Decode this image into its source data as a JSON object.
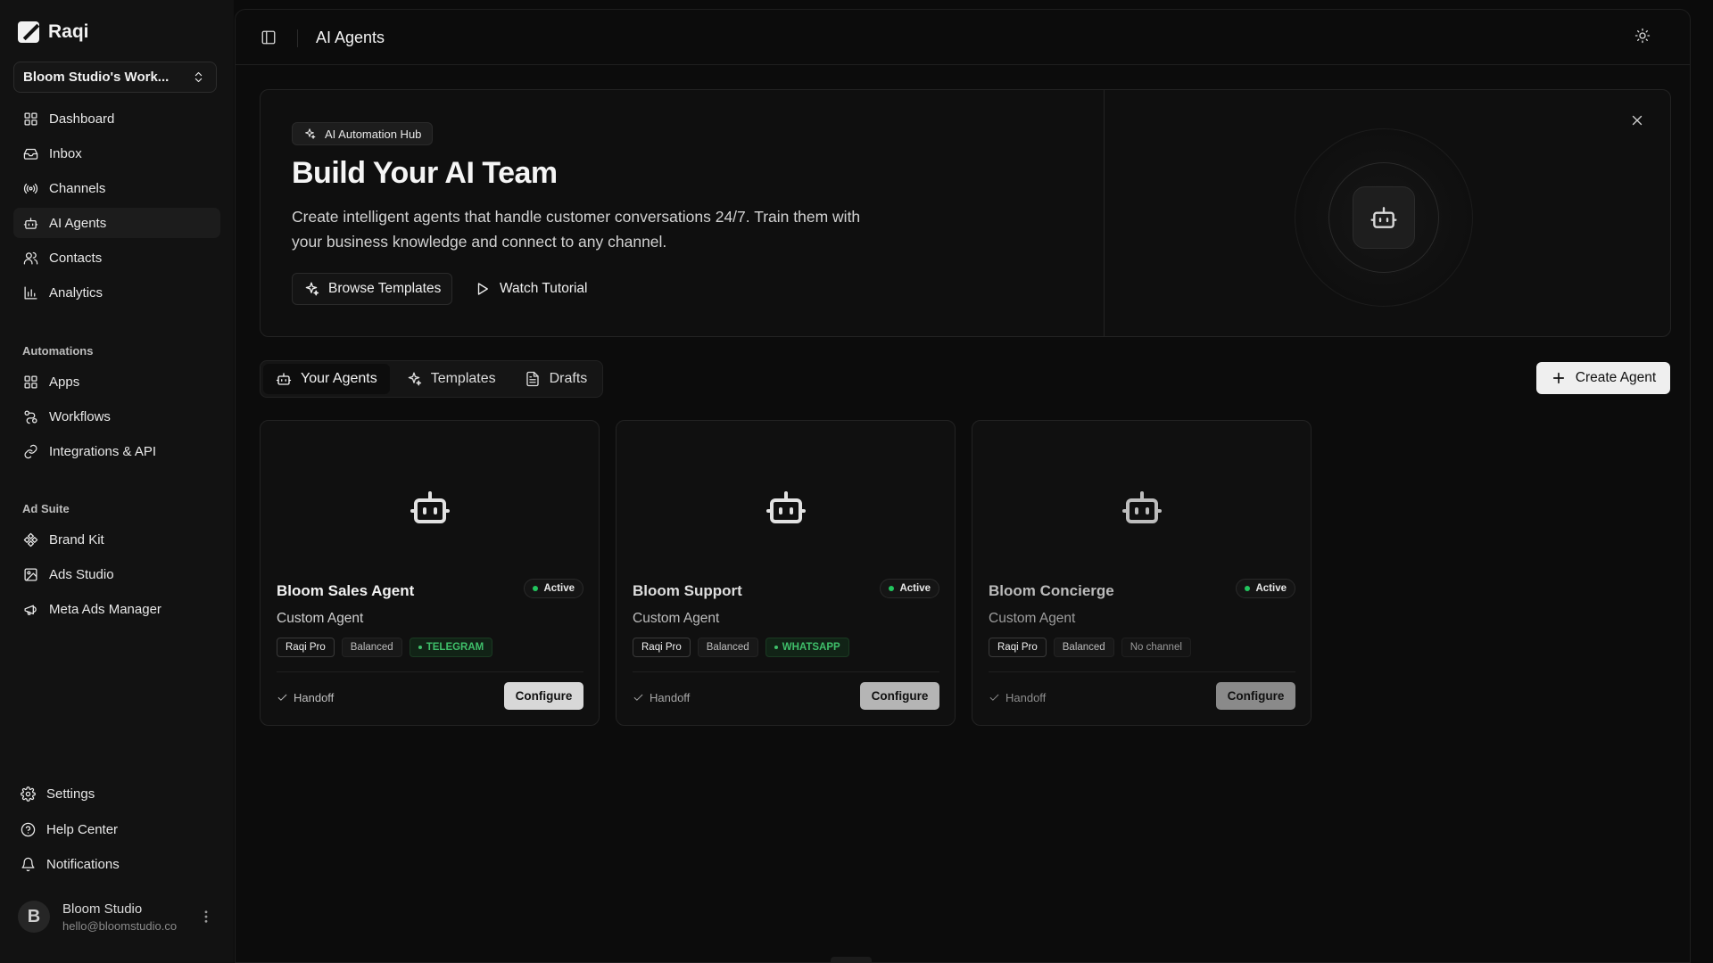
{
  "brand": {
    "name": "Raqi",
    "icon": "raqi-logo-icon"
  },
  "workspace": {
    "label": "Bloom Studio's Work..."
  },
  "nav": {
    "main": [
      {
        "label": "Dashboard",
        "icon": "grid-icon"
      },
      {
        "label": "Inbox",
        "icon": "inbox-icon"
      },
      {
        "label": "Channels",
        "icon": "broadcast-icon"
      },
      {
        "label": "AI Agents",
        "icon": "bot-icon",
        "active": true
      },
      {
        "label": "Contacts",
        "icon": "users-icon"
      },
      {
        "label": "Analytics",
        "icon": "bar-chart-icon"
      }
    ],
    "automations_label": "Automations",
    "automations": [
      {
        "label": "Apps",
        "icon": "apps-grid-icon"
      },
      {
        "label": "Workflows",
        "icon": "workflow-icon"
      },
      {
        "label": "Integrations & API",
        "icon": "link-icon"
      }
    ],
    "adsuite_label": "Ad Suite",
    "adsuite": [
      {
        "label": "Brand Kit",
        "icon": "diamond-icon"
      },
      {
        "label": "Ads Studio",
        "icon": "image-icon"
      },
      {
        "label": "Meta Ads Manager",
        "icon": "megaphone-icon"
      }
    ],
    "bottom": [
      {
        "label": "Settings",
        "icon": "gear-icon"
      },
      {
        "label": "Help Center",
        "icon": "help-circle-icon"
      },
      {
        "label": "Notifications",
        "icon": "bell-icon"
      }
    ]
  },
  "user": {
    "initial": "B",
    "name": "Bloom Studio",
    "email": "hello@bloomstudio.co"
  },
  "header": {
    "title": "AI Agents"
  },
  "hero": {
    "badge": "AI Automation Hub",
    "title": "Build Your AI Team",
    "description": "Create intelligent agents that handle customer conversations 24/7. Train them with your business knowledge and connect to any channel.",
    "primary_btn": "Browse Templates",
    "secondary_btn": "Watch Tutorial"
  },
  "tabs": [
    {
      "label": "Your Agents",
      "icon": "bot-icon",
      "active": true
    },
    {
      "label": "Templates",
      "icon": "sparkles-icon"
    },
    {
      "label": "Drafts",
      "icon": "document-icon"
    }
  ],
  "create_btn": "Create Agent",
  "agents": [
    {
      "name": "Bloom Sales Agent",
      "status": "Active",
      "type": "Custom Agent",
      "plan": "Raqi Pro",
      "mode": "Balanced",
      "channel": "TELEGRAM",
      "handoff": "Handoff",
      "action": "Configure"
    },
    {
      "name": "Bloom Support",
      "status": "Active",
      "type": "Custom Agent",
      "plan": "Raqi Pro",
      "mode": "Balanced",
      "channel": "WHATSAPP",
      "handoff": "Handoff",
      "action": "Configure"
    },
    {
      "name": "Bloom Concierge",
      "status": "Active",
      "type": "Custom Agent",
      "plan": "Raqi Pro",
      "mode": "Balanced",
      "channel": "No channel",
      "handoff": "Handoff",
      "action": "Configure"
    }
  ],
  "colors": {
    "accent_green": "#22c55e",
    "background": "#0b0b0b",
    "button_light": "#efefef"
  }
}
